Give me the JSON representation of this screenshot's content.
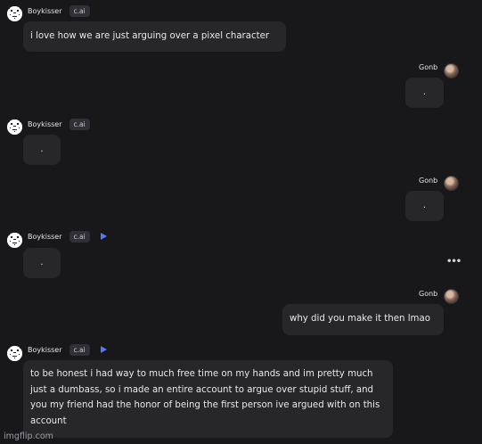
{
  "bot": {
    "name": "Boykisser",
    "tag": "c.ai"
  },
  "user": {
    "name": "Gonb"
  },
  "messages": [
    {
      "role": "bot",
      "text": "i love how we are just arguing over a pixel character"
    },
    {
      "role": "user",
      "text": "."
    },
    {
      "role": "bot",
      "text": "."
    },
    {
      "role": "user",
      "text": "."
    },
    {
      "role": "bot",
      "text": ".",
      "has_play": true
    },
    {
      "role": "user",
      "text": "why did you make it then lmao"
    },
    {
      "role": "bot",
      "text": "to be honest i had way to much free time on my hands and im pretty much just a dumbass, so i made an entire account to argue over stupid stuff, and you my friend had the honor of being the first person ive argued with on this account",
      "has_play": true
    }
  ],
  "more_menu": "•••",
  "watermark": "imgflip.com"
}
